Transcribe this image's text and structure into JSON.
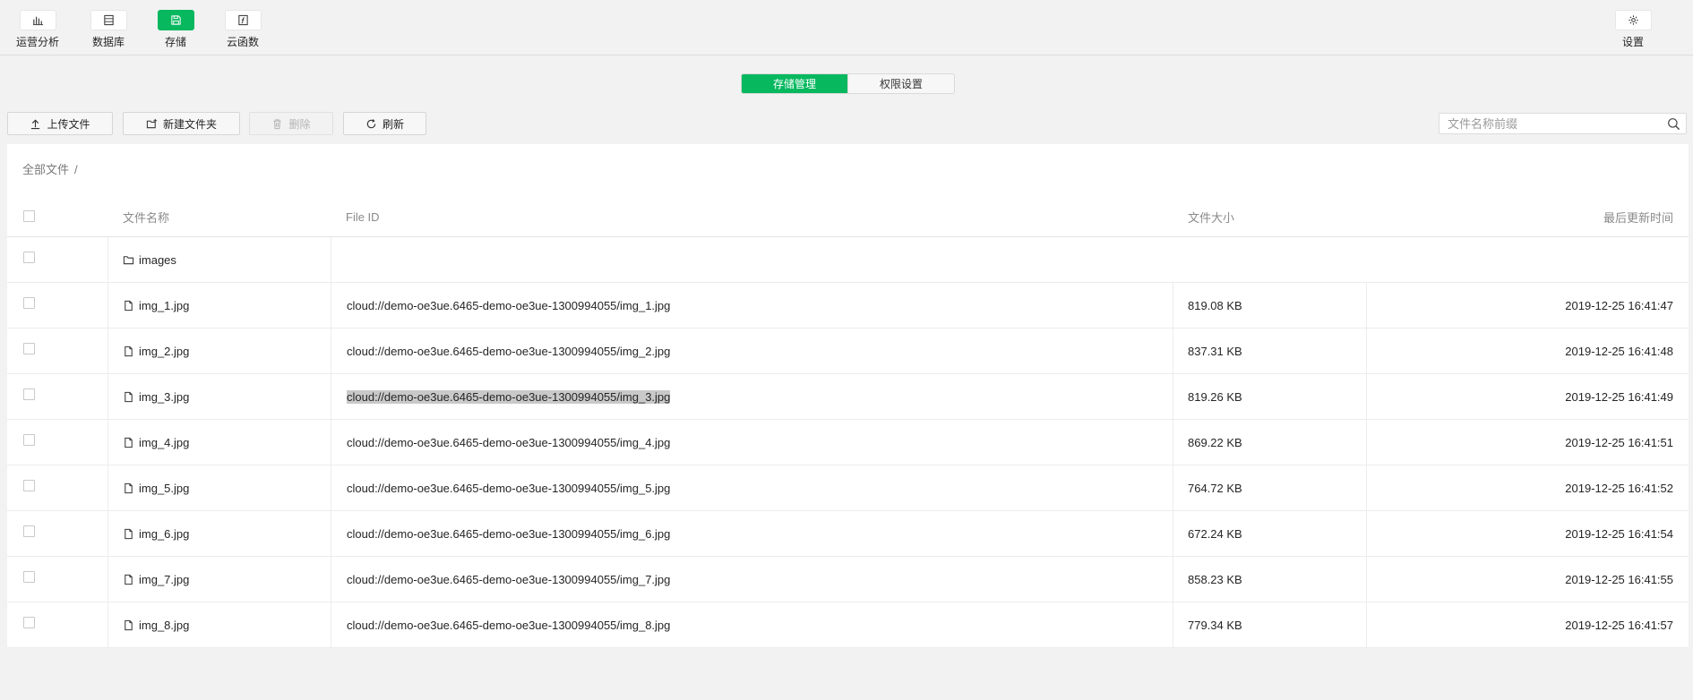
{
  "toolbar": {
    "items": [
      {
        "label": "运营分析",
        "icon": "bar-chart-icon",
        "active": false
      },
      {
        "label": "数据库",
        "icon": "database-icon",
        "active": false
      },
      {
        "label": "存储",
        "icon": "storage-icon",
        "active": true
      },
      {
        "label": "云函数",
        "icon": "function-icon",
        "active": false
      }
    ],
    "settings_label": "设置"
  },
  "tabs": [
    {
      "label": "存储管理",
      "active": true
    },
    {
      "label": "权限设置",
      "active": false
    }
  ],
  "actions": {
    "upload_label": "上传文件",
    "new_folder_label": "新建文件夹",
    "delete_label": "删除",
    "refresh_label": "刷新"
  },
  "search": {
    "placeholder": "文件名称前缀",
    "value": ""
  },
  "breadcrumb": {
    "root": "全部文件",
    "separator": "/"
  },
  "table": {
    "columns": {
      "name": "文件名称",
      "file_id": "File ID",
      "size": "文件大小",
      "updated": "最后更新时间"
    },
    "folder": {
      "name": "images"
    },
    "rows": [
      {
        "name": "img_1.jpg",
        "file_id": "cloud://demo-oe3ue.6465-demo-oe3ue-1300994055/img_1.jpg",
        "size": "819.08 KB",
        "updated": "2019-12-25 16:41:47",
        "selected_id": false
      },
      {
        "name": "img_2.jpg",
        "file_id": "cloud://demo-oe3ue.6465-demo-oe3ue-1300994055/img_2.jpg",
        "size": "837.31 KB",
        "updated": "2019-12-25 16:41:48",
        "selected_id": false
      },
      {
        "name": "img_3.jpg",
        "file_id": "cloud://demo-oe3ue.6465-demo-oe3ue-1300994055/img_3.jpg",
        "size": "819.26 KB",
        "updated": "2019-12-25 16:41:49",
        "selected_id": true
      },
      {
        "name": "img_4.jpg",
        "file_id": "cloud://demo-oe3ue.6465-demo-oe3ue-1300994055/img_4.jpg",
        "size": "869.22 KB",
        "updated": "2019-12-25 16:41:51",
        "selected_id": false
      },
      {
        "name": "img_5.jpg",
        "file_id": "cloud://demo-oe3ue.6465-demo-oe3ue-1300994055/img_5.jpg",
        "size": "764.72 KB",
        "updated": "2019-12-25 16:41:52",
        "selected_id": false
      },
      {
        "name": "img_6.jpg",
        "file_id": "cloud://demo-oe3ue.6465-demo-oe3ue-1300994055/img_6.jpg",
        "size": "672.24 KB",
        "updated": "2019-12-25 16:41:54",
        "selected_id": false
      },
      {
        "name": "img_7.jpg",
        "file_id": "cloud://demo-oe3ue.6465-demo-oe3ue-1300994055/img_7.jpg",
        "size": "858.23 KB",
        "updated": "2019-12-25 16:41:55",
        "selected_id": false
      },
      {
        "name": "img_8.jpg",
        "file_id": "cloud://demo-oe3ue.6465-demo-oe3ue-1300994055/img_8.jpg",
        "size": "779.34 KB",
        "updated": "2019-12-25 16:41:57",
        "selected_id": false
      }
    ]
  },
  "colors": {
    "accent": "#07b85f",
    "selection": "#c9c9c9"
  }
}
